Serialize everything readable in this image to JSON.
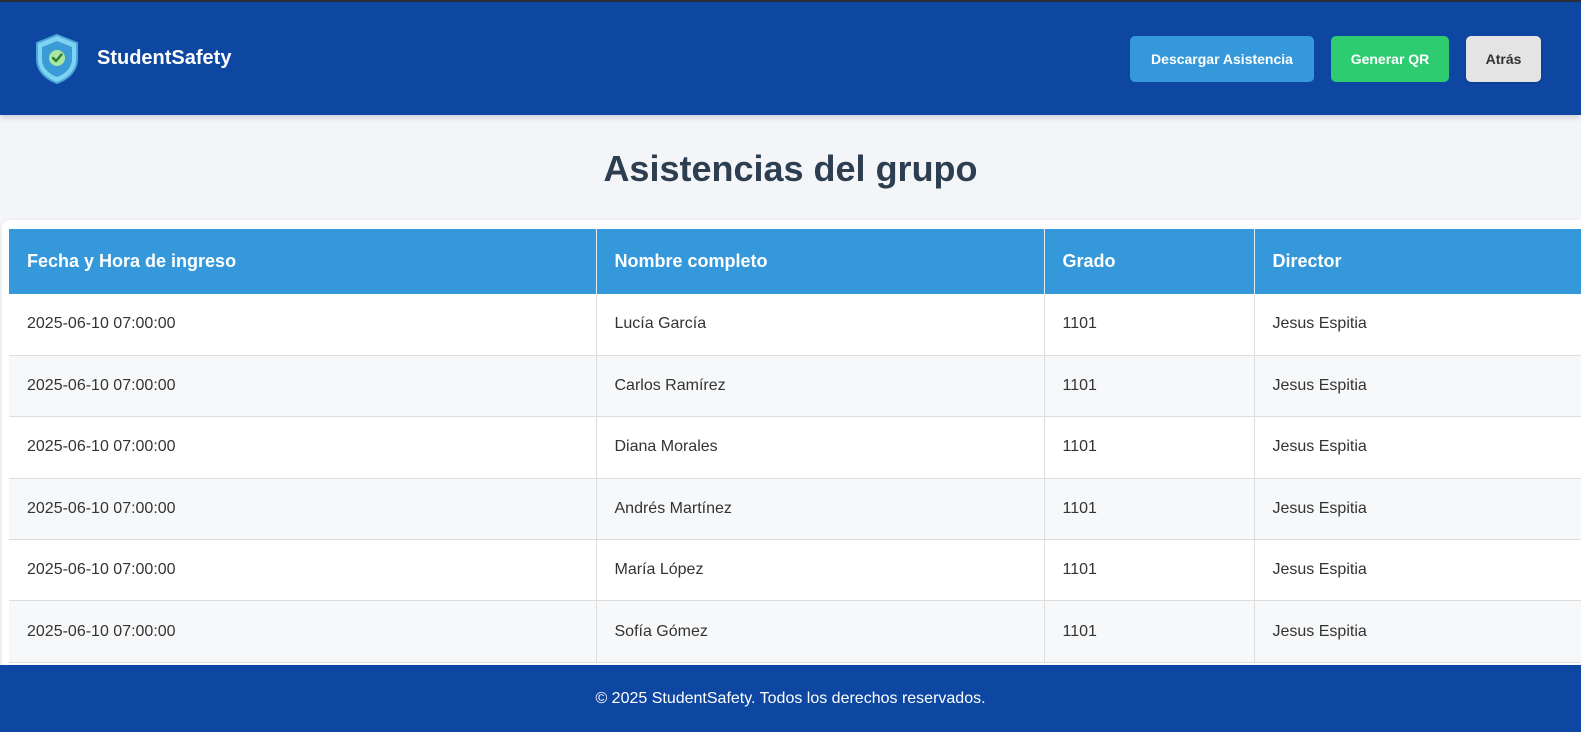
{
  "app": {
    "name": "StudentSafety",
    "logo_icon": "shield-check-icon"
  },
  "header": {
    "buttons": {
      "download": "Descargar Asistencia",
      "qr": "Generar QR",
      "back": "Atrás"
    }
  },
  "page": {
    "title": "Asistencias del grupo"
  },
  "table": {
    "columns": [
      "Fecha y Hora de ingreso",
      "Nombre completo",
      "Grado",
      "Director"
    ],
    "rows": [
      [
        "2025-06-10 07:00:00",
        "Lucía García",
        "1101",
        "Jesus Espitia"
      ],
      [
        "2025-06-10 07:00:00",
        "Carlos Ramírez",
        "1101",
        "Jesus Espitia"
      ],
      [
        "2025-06-10 07:00:00",
        "Diana Morales",
        "1101",
        "Jesus Espitia"
      ],
      [
        "2025-06-10 07:00:00",
        "Andrés Martínez",
        "1101",
        "Jesus Espitia"
      ],
      [
        "2025-06-10 07:00:00",
        "María López",
        "1101",
        "Jesus Espitia"
      ],
      [
        "2025-06-10 07:00:00",
        "Sofía Gómez",
        "1101",
        "Jesus Espitia"
      ]
    ]
  },
  "footer": {
    "text": "© 2025 StudentSafety. Todos los derechos reservados."
  },
  "colors": {
    "header_bg": "#0e47a1",
    "download_button": "#3498db",
    "qr_button": "#2ecc71",
    "back_button": "#e4e4e4",
    "table_header": "#3498db",
    "title_text": "#2c3e50"
  }
}
